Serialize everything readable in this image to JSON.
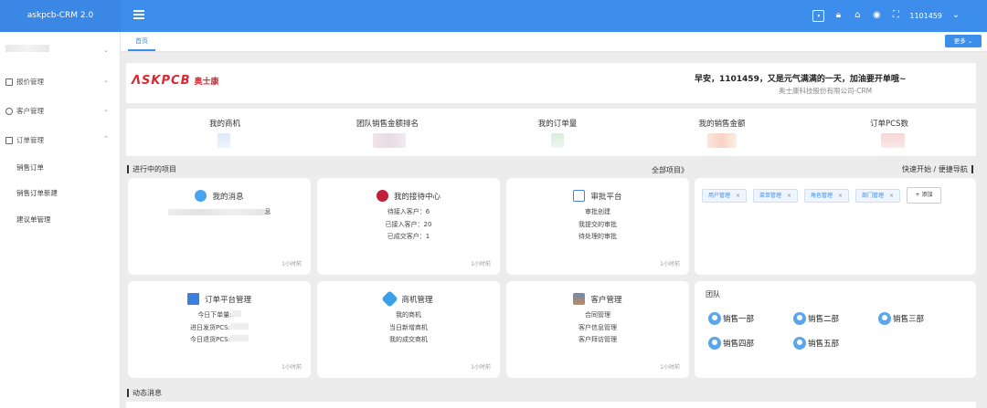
{
  "app": {
    "title": "askpcb-CRM 2.0"
  },
  "header": {
    "user": "1101459"
  },
  "sidebar": {
    "menus": [
      {
        "label": "报价管理"
      },
      {
        "label": "客户管理"
      },
      {
        "label": "订单管理"
      }
    ],
    "sub_items": [
      {
        "label": "销售订单"
      },
      {
        "label": "销售订单新建"
      },
      {
        "label": "建议单管理"
      }
    ]
  },
  "tabs": {
    "home": "首页",
    "more": "更多"
  },
  "welcome": {
    "logo_en": "ΛSKPCB",
    "logo_cn": "奥士康",
    "greeting": "早安，1101459，又是元气满满的一天，加油要开单哦~",
    "company": "奥士康科技股份有限公司-CRM"
  },
  "stats": [
    {
      "label": "我的商机"
    },
    {
      "label": "团队销售金额排名"
    },
    {
      "label": "我的订单量"
    },
    {
      "label": "我的销售金额"
    },
    {
      "label": "订单PCS数"
    }
  ],
  "sections": {
    "in_progress": "进行中的项目",
    "all_projects": "全部项目》",
    "quick_nav": "快速开始 / 便捷导航",
    "dynamic": "动态消息"
  },
  "panels": [
    {
      "title": "我的消息",
      "lines": [
        "息"
      ],
      "time": "1小时前"
    },
    {
      "title": "我的接待中心",
      "lines": [
        "待接入客户：6",
        "已接入客户：20",
        "已成交客户：1"
      ],
      "time": "1小时前"
    },
    {
      "title": "审批平台",
      "lines": [
        "审批创建",
        "我提交的审批",
        "待处理的审批"
      ],
      "time": "1小时前"
    },
    {
      "title": "订单平台管理",
      "lines": [
        "今日下单量:",
        "进日发货PCS:",
        "今日退货PCS:"
      ],
      "time": "1小时前"
    },
    {
      "title": "商机管理",
      "lines": [
        "我的商机",
        "当日新增商机",
        "我的成交商机"
      ],
      "time": "1小时前"
    },
    {
      "title": "客户管理",
      "lines": [
        "合同管理",
        "客户信息管理",
        "客户拜访管理"
      ],
      "time": "1小时前"
    }
  ],
  "shortcuts": {
    "chips": [
      "用户管理",
      "菜单管理",
      "角色管理",
      "部门管理"
    ],
    "add": "+ 添加"
  },
  "team": {
    "title": "团队",
    "groups": [
      "销售一部",
      "销售二部",
      "销售三部",
      "销售四部",
      "销售五部"
    ]
  }
}
